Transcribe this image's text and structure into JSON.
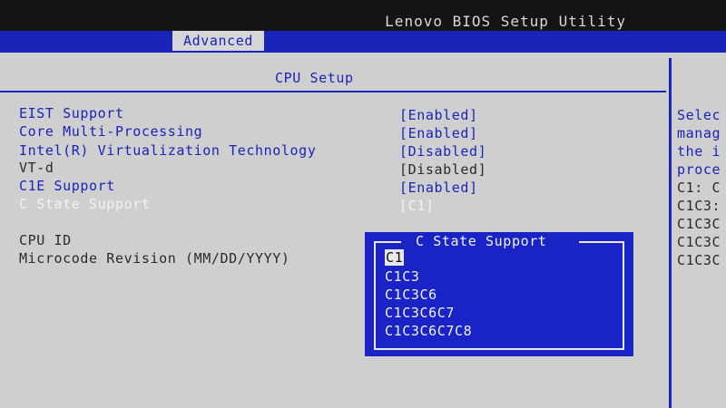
{
  "header": {
    "title": "Lenovo BIOS Setup Utility",
    "active_tab": "Advanced"
  },
  "panel": {
    "title": "CPU Setup"
  },
  "settings": [
    {
      "label": "EIST Support",
      "value": "[Enabled]"
    },
    {
      "label": "Core Multi-Processing",
      "value": "[Enabled]"
    },
    {
      "label": "Intel(R) Virtualization Technology",
      "value": "[Disabled]"
    },
    {
      "label": "VT-d",
      "value": "[Disabled]"
    },
    {
      "label": "C1E Support",
      "value": "[Enabled]"
    },
    {
      "label": "C State Support",
      "value": "[C1]"
    }
  ],
  "info": {
    "cpu_id_label": "CPU ID",
    "microcode_label": "Microcode Revision (MM/DD/YYYY)"
  },
  "popup": {
    "title": "C State Support",
    "options": [
      "C1",
      "C1C3",
      "C1C3C6",
      "C1C3C6C7",
      "C1C3C6C7C8"
    ],
    "selected": "C1"
  },
  "help_text": [
    "Selec",
    "manag",
    "the i",
    "proce",
    "C1: C",
    "C1C3:",
    "C1C3C",
    "C1C3C",
    "C1C3C"
  ],
  "colors": {
    "bios_blue": "#1a24b8",
    "popup_blue": "#1a24c6",
    "background": "#cfcfcf"
  }
}
